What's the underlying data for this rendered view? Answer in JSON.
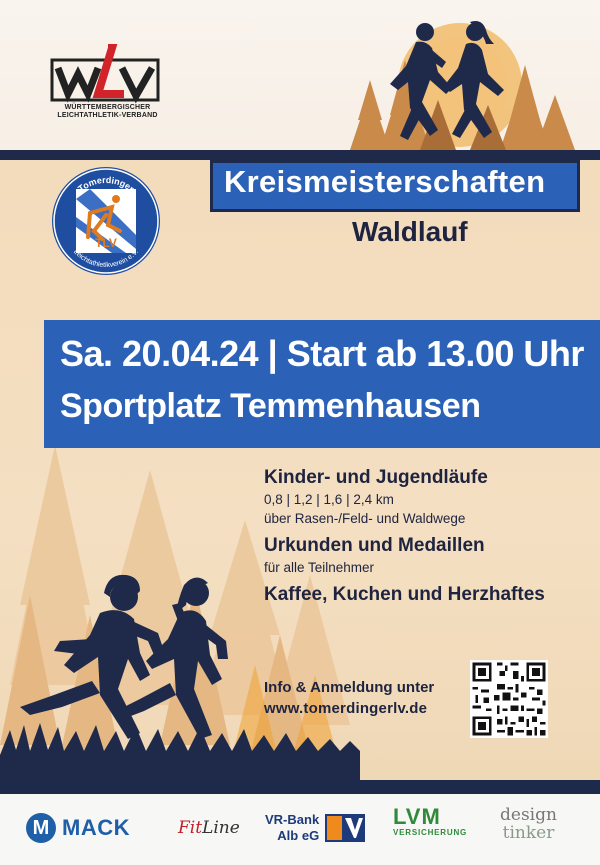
{
  "header": {
    "wlv_logo": "WLV",
    "wlv_org": "WÜRTTEMBERGISCHER LEICHTATHLETIK-VERBAND"
  },
  "club": {
    "name_top": "Tomerdinger",
    "initials": "TLV",
    "name_bottom": "Leichtathletikverein e.V."
  },
  "event": {
    "title": "Kreismeisterschaften",
    "subtitle": "Waldlauf",
    "date_line": "Sa. 20.04.24 | Start ab 13.00 Uhr",
    "venue": "Sportplatz Temmenhausen"
  },
  "info": {
    "youth_heading": "Kinder- und Jugendläufe",
    "distances": "0,8 | 1,2 | 1,6 | 2,4 km",
    "terrain": "über Rasen-/Feld- und Waldwege",
    "awards_heading": "Urkunden und Medaillen",
    "awards_text": "für alle Teilnehmer",
    "food": "Kaffee, Kuchen und Herzhaftes"
  },
  "contact": {
    "label": "Info & Anmeldung unter",
    "url": "www.tomerdingerlv.de"
  },
  "sponsors": {
    "mack_icon": "M",
    "mack": "MACK",
    "fitline_a": "Fit",
    "fitline_b": "Line",
    "vr_line1": "VR-Bank",
    "vr_line2": "Alb eG",
    "lvm": "LVM",
    "lvm_sub": "VERSICHERUNG",
    "design_1": "design",
    "design_2": "tinker"
  },
  "colors": {
    "brand_blue": "#2b62b8",
    "navy": "#1f2a4a",
    "cream": "#f3dcbc",
    "silhouette": "#1f2a4a"
  },
  "icons": [
    "wlv-logo",
    "tlv-club-badge",
    "runner-silhouettes",
    "pine-trees",
    "qr-code",
    "vr-bank-logo"
  ]
}
